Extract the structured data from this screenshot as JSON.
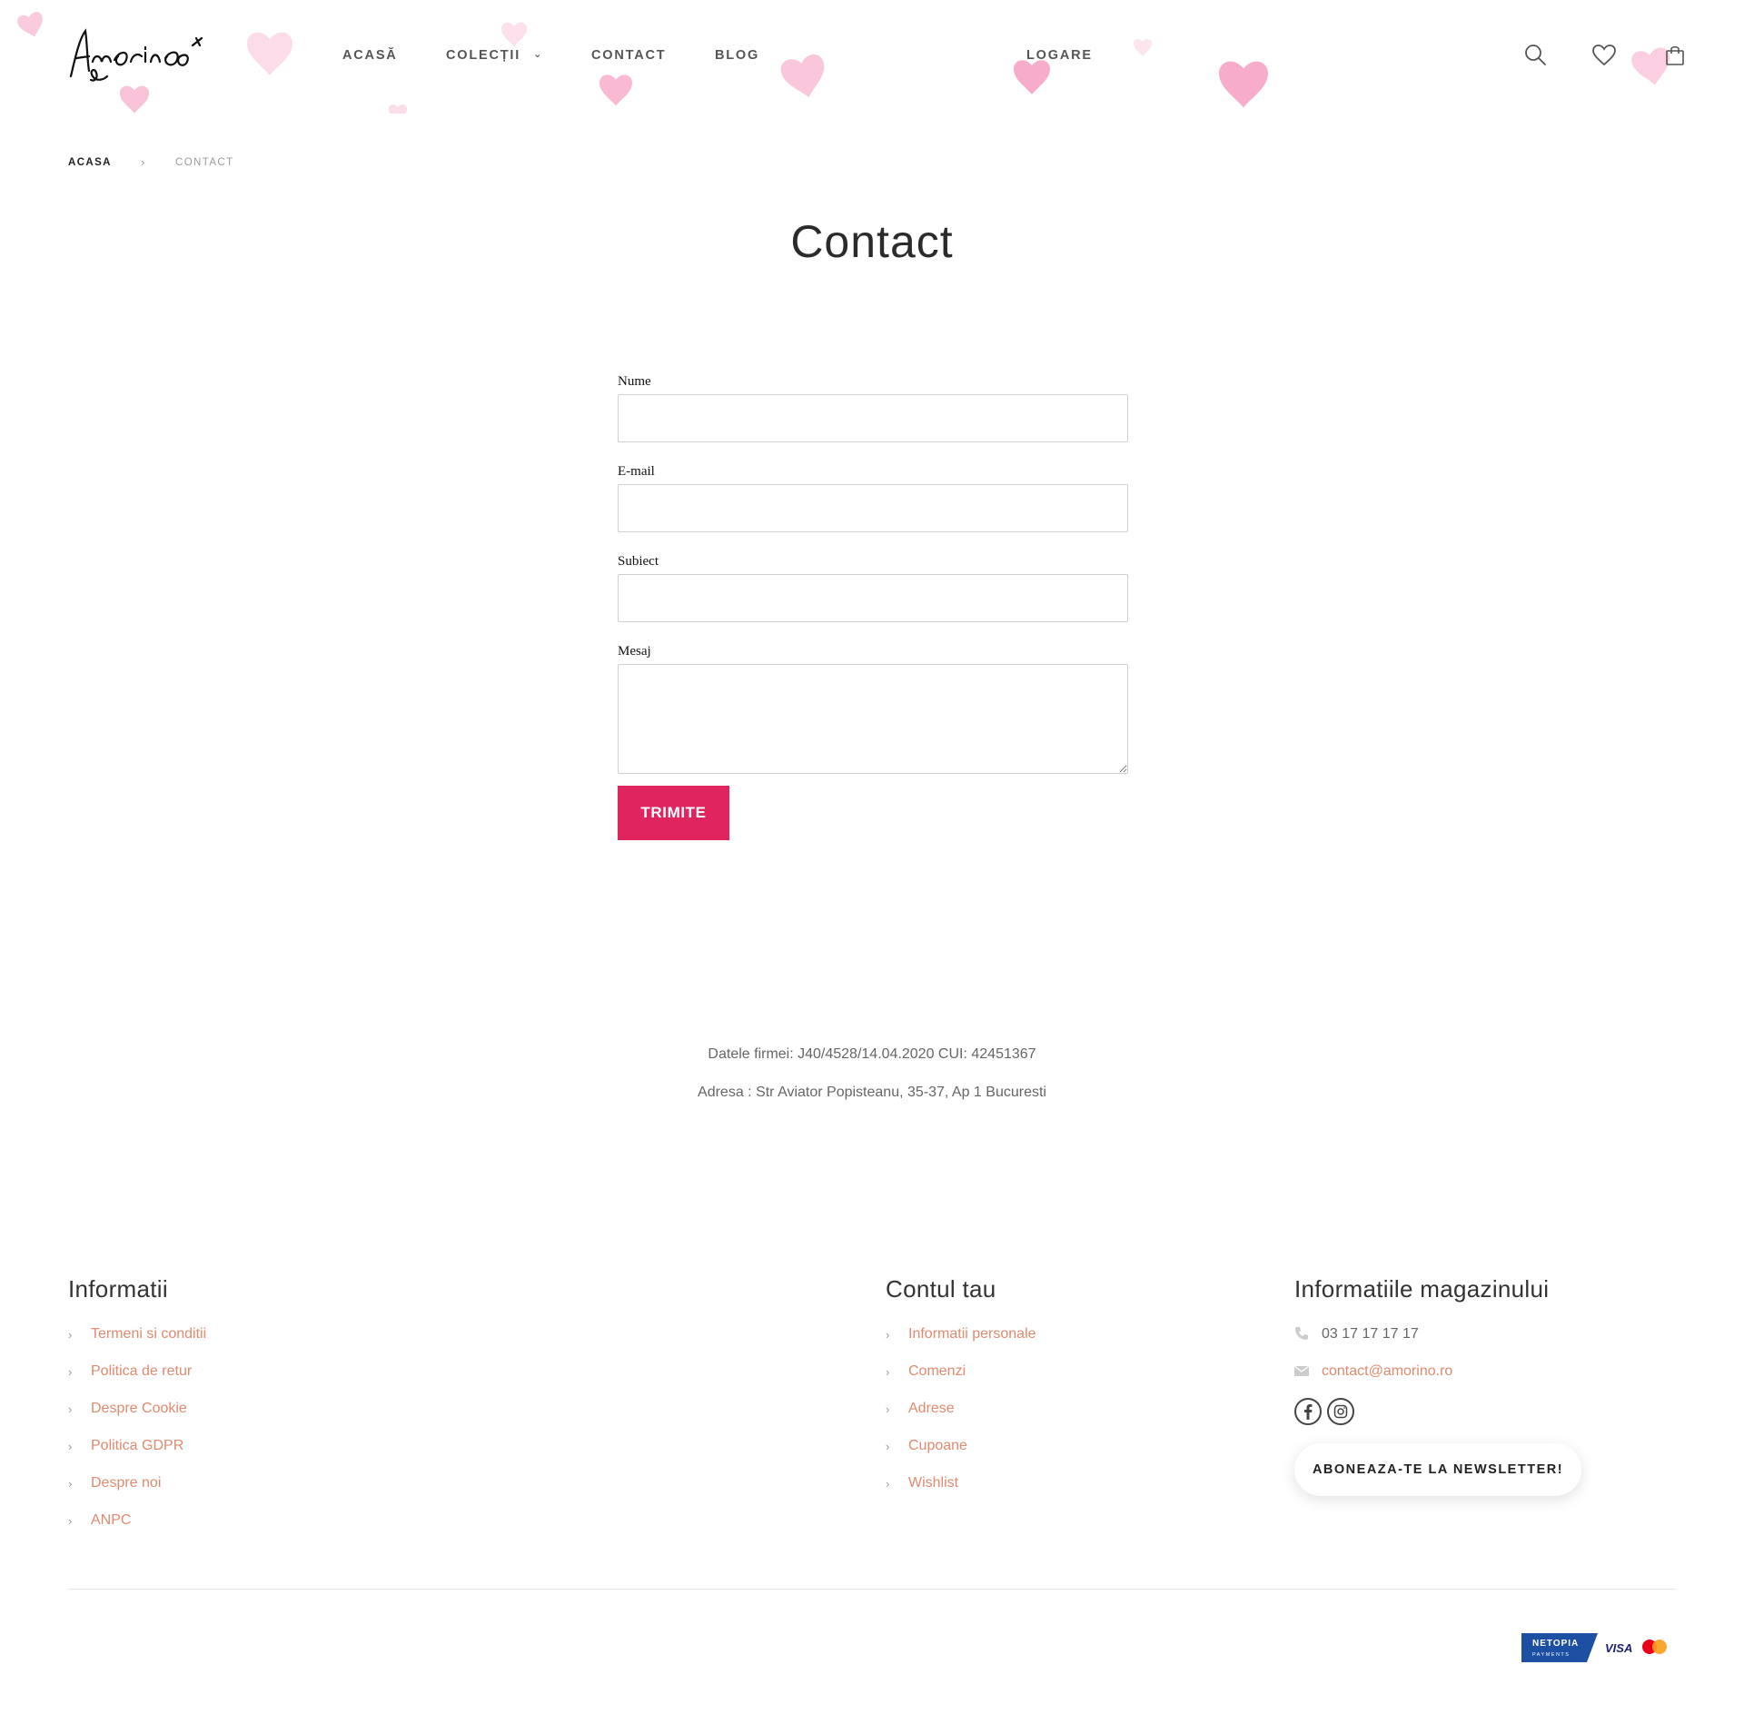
{
  "brand": {
    "logo_text": "Amorino",
    "accent_color": "#e0245e",
    "link_color": "#e08a6f",
    "heart_color": "#f7a8c8"
  },
  "nav": {
    "items": [
      "ACASĂ",
      "COLECȚII",
      "CONTACT",
      "BLOG"
    ],
    "login": "LOGARE",
    "icons": [
      "search-icon",
      "heart-icon",
      "shopping-bag-icon"
    ]
  },
  "breadcrumb": {
    "home": "ACASA",
    "separator": "›",
    "current": "CONTACT"
  },
  "page": {
    "title": "Contact"
  },
  "form": {
    "name_label": "Nume",
    "name_value": "",
    "email_label": "E-mail",
    "email_value": "",
    "subject_label": "Subiect",
    "subject_value": "",
    "message_label": "Mesaj",
    "message_value": "",
    "submit_label": "TRIMITE"
  },
  "company": {
    "registration": "Datele firmei: J40/4528/14.04.2020 CUI: 42451367",
    "address": "Adresa : Str Aviator Popisteanu, 35-37, Ap 1 Bucuresti"
  },
  "footer": {
    "info": {
      "title": "Informatii",
      "links": [
        "Termeni si conditii",
        "Politica de retur",
        "Despre Cookie",
        "Politica GDPR",
        "Despre noi",
        "ANPC"
      ]
    },
    "account": {
      "title": "Contul tau",
      "links": [
        "Informatii personale",
        "Comenzi",
        "Adrese",
        "Cupoane",
        "Wishlist"
      ]
    },
    "store": {
      "title": "Informatiile magazinului",
      "phone": "03 17 17 17 17",
      "email": "contact@amorino.ro",
      "social_icons": [
        "facebook-icon",
        "instagram-icon"
      ],
      "newsletter_label": "ABONEAZA-TE LA NEWSLETTER!"
    },
    "payments": {
      "netopia": "NETOPIA",
      "netopia_sub": "PAYMENTS",
      "visa": "VISA"
    }
  }
}
